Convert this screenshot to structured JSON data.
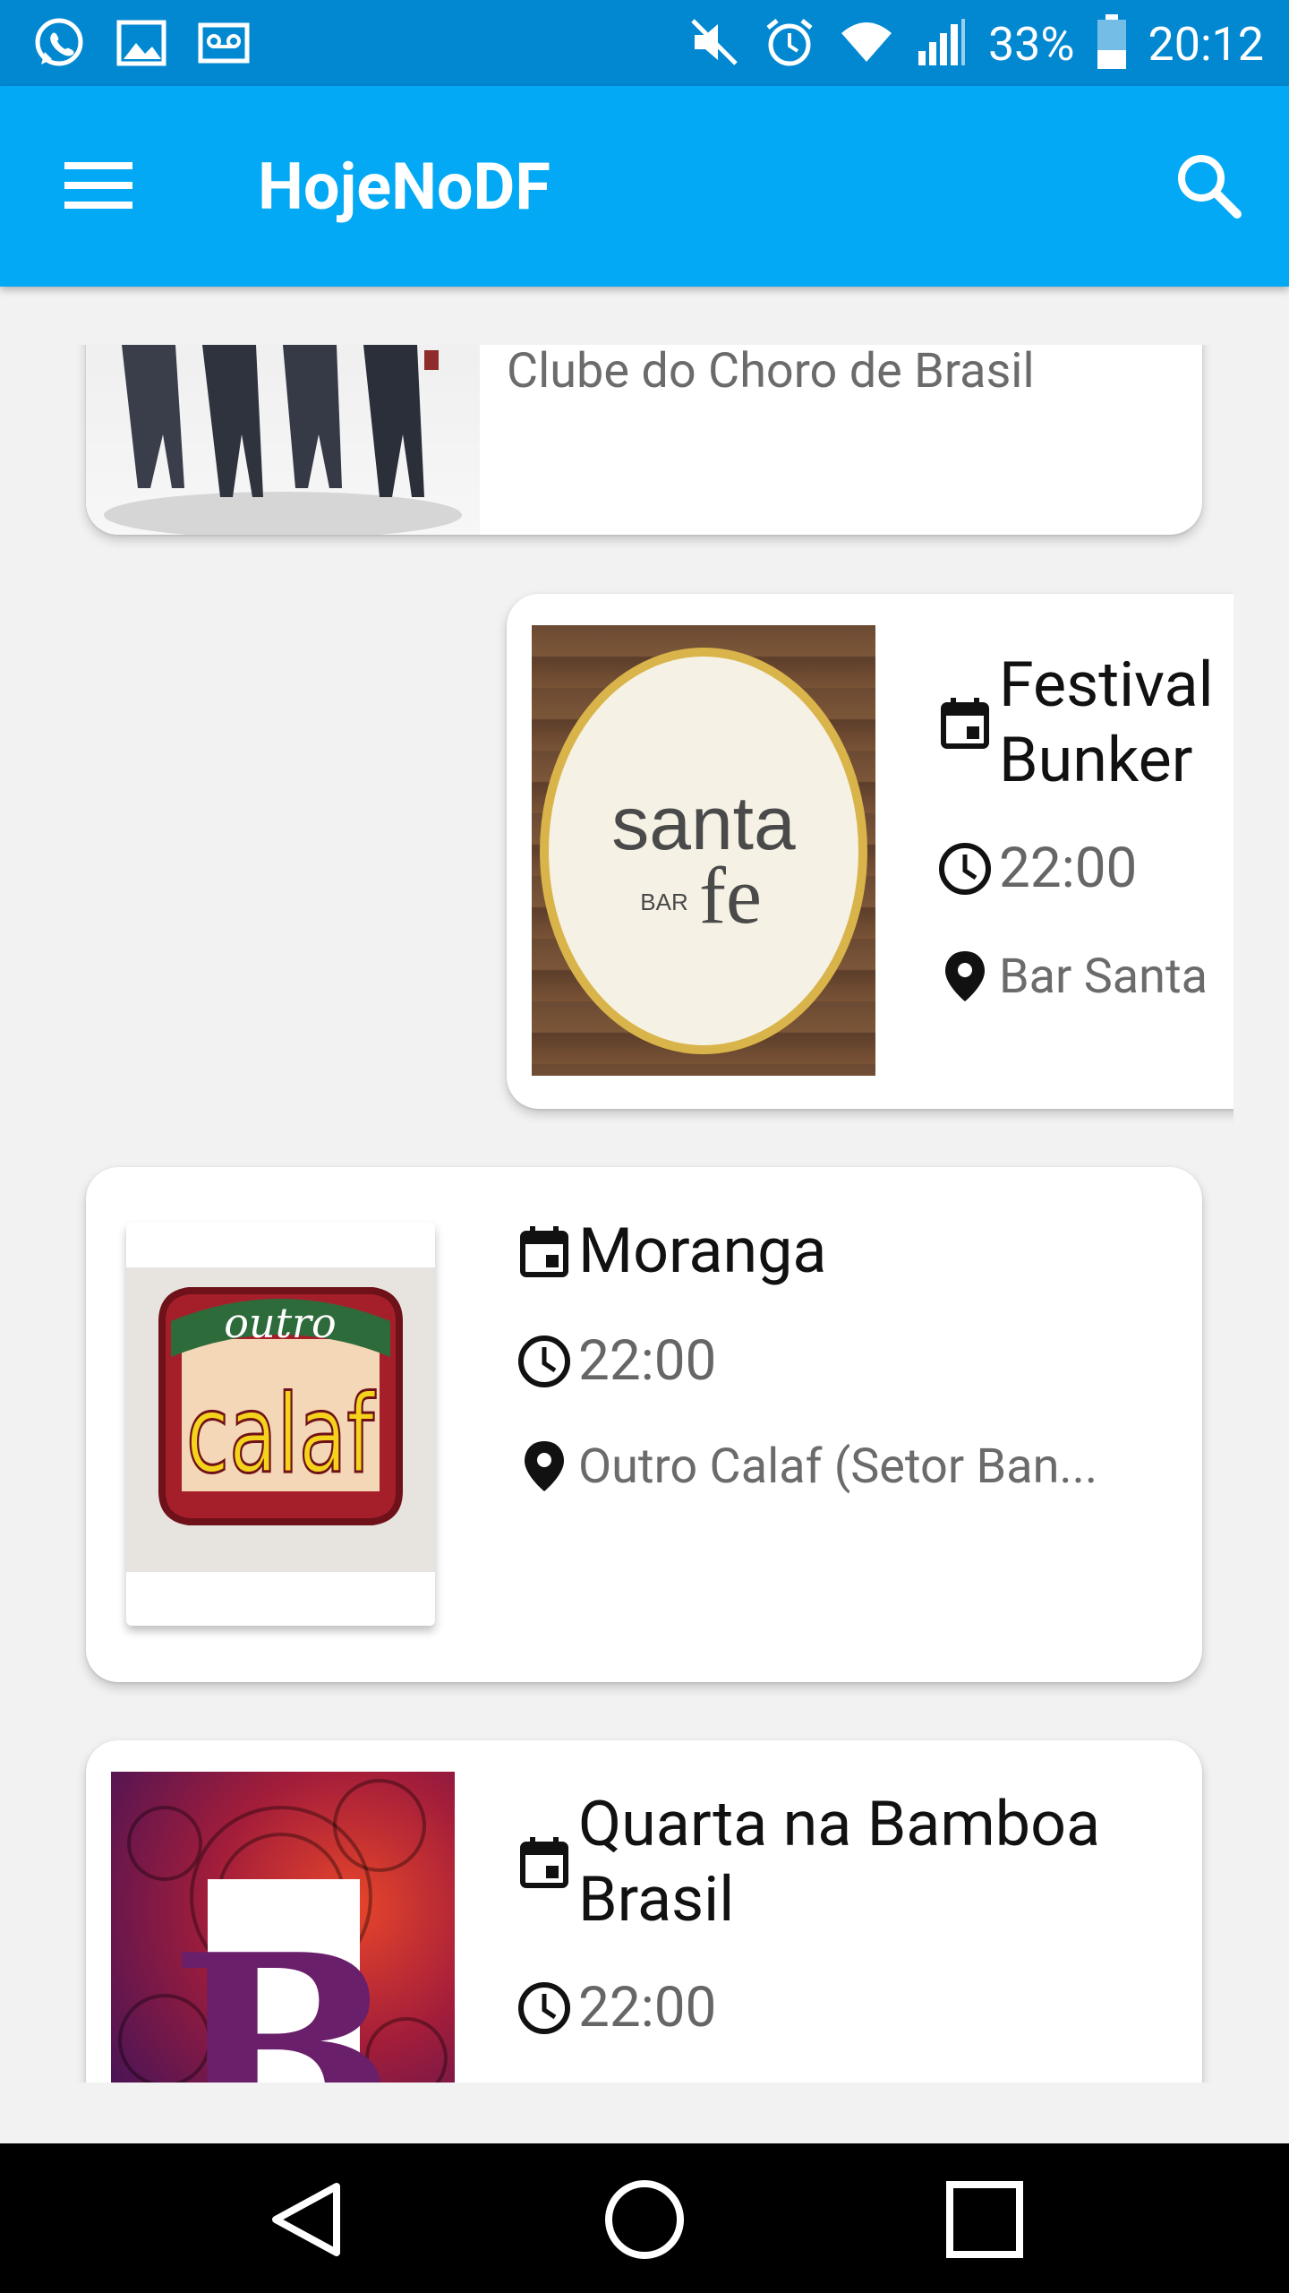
{
  "status_bar": {
    "battery": "33%",
    "time": "20:12",
    "icons": [
      "whatsapp-icon",
      "gallery-icon",
      "voicemail-icon",
      "mute-icon",
      "alarm-icon",
      "wifi-icon",
      "signal-icon",
      "battery-icon"
    ]
  },
  "app_bar": {
    "title": "HojeNoDF",
    "icons": [
      "menu-icon",
      "search-icon"
    ]
  },
  "events": [
    {
      "title": "Clube do Choro de Brasil",
      "time": "",
      "place": ""
    },
    {
      "title": "Festival Bunker",
      "time": "22:00",
      "place": "Bar Santa",
      "image_text": [
        "santa",
        "BAR",
        "fe"
      ]
    },
    {
      "title": "Moranga",
      "time": "22:00",
      "place": "Outro Calaf (Setor Ban...",
      "image_text": [
        "outro",
        "calaf"
      ]
    },
    {
      "title": "Quarta na Bamboa Brasil",
      "time": "22:00",
      "place": "",
      "image_text": [
        "B"
      ]
    }
  ],
  "row_icons": [
    "calendar-icon",
    "clock-icon",
    "location-pin-icon"
  ],
  "nav_bar": {
    "icons": [
      "back-icon",
      "home-icon",
      "recents-icon"
    ]
  },
  "colors": {
    "status_bar": "#0288d1",
    "app_bar": "#03a9f4",
    "background": "#f2f2f2",
    "nav_bar": "#000000"
  }
}
